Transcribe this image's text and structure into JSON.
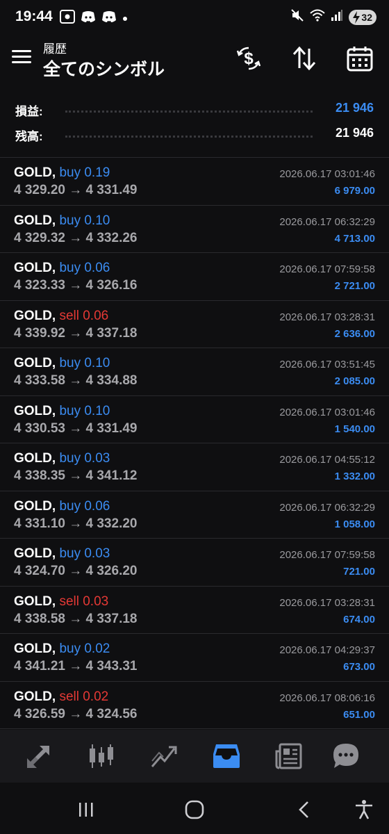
{
  "status_bar": {
    "time": "19:44",
    "battery": "32",
    "icons": [
      "screen-record-icon",
      "discord-icon",
      "discord-icon",
      "notification-dot-icon",
      "mute-icon",
      "wifi-icon",
      "signal-icon",
      "battery-icon"
    ]
  },
  "header": {
    "subtitle": "履歴",
    "title": "全てのシンボル",
    "icons": [
      "menu-icon",
      "currency-exchange-icon",
      "sort-icon",
      "calendar-icon"
    ]
  },
  "summary": {
    "profit_label": "損益:",
    "profit_value": "21 946",
    "balance_label": "残高:",
    "balance_value": "21 946"
  },
  "colors": {
    "background": "#0f0f11",
    "accent_blue": "#3b8cf2",
    "sell_red": "#e53935",
    "muted_text": "#a8a8ac"
  },
  "trades": [
    {
      "symbol": "GOLD,",
      "side": "buy",
      "volume": "buy 0.19",
      "prices": "4 329.20 → 4 331.49",
      "time": "2026.06.17 03:01:46",
      "profit": "6 979.00"
    },
    {
      "symbol": "GOLD,",
      "side": "buy",
      "volume": "buy 0.10",
      "prices": "4 329.32 → 4 332.26",
      "time": "2026.06.17 06:32:29",
      "profit": "4 713.00"
    },
    {
      "symbol": "GOLD,",
      "side": "buy",
      "volume": "buy 0.06",
      "prices": "4 323.33 → 4 326.16",
      "time": "2026.06.17 07:59:58",
      "profit": "2 721.00"
    },
    {
      "symbol": "GOLD,",
      "side": "sell",
      "volume": "sell 0.06",
      "prices": "4 339.92 → 4 337.18",
      "time": "2026.06.17 03:28:31",
      "profit": "2 636.00"
    },
    {
      "symbol": "GOLD,",
      "side": "buy",
      "volume": "buy 0.10",
      "prices": "4 333.58 → 4 334.88",
      "time": "2026.06.17 03:51:45",
      "profit": "2 085.00"
    },
    {
      "symbol": "GOLD,",
      "side": "buy",
      "volume": "buy 0.10",
      "prices": "4 330.53 → 4 331.49",
      "time": "2026.06.17 03:01:46",
      "profit": "1 540.00"
    },
    {
      "symbol": "GOLD,",
      "side": "buy",
      "volume": "buy 0.03",
      "prices": "4 338.35 → 4 341.12",
      "time": "2026.06.17 04:55:12",
      "profit": "1 332.00"
    },
    {
      "symbol": "GOLD,",
      "side": "buy",
      "volume": "buy 0.06",
      "prices": "4 331.10 → 4 332.20",
      "time": "2026.06.17 06:32:29",
      "profit": "1 058.00"
    },
    {
      "symbol": "GOLD,",
      "side": "buy",
      "volume": "buy 0.03",
      "prices": "4 324.70 → 4 326.20",
      "time": "2026.06.17 07:59:58",
      "profit": "721.00"
    },
    {
      "symbol": "GOLD,",
      "side": "sell",
      "volume": "sell 0.03",
      "prices": "4 338.58 → 4 337.18",
      "time": "2026.06.17 03:28:31",
      "profit": "674.00"
    },
    {
      "symbol": "GOLD,",
      "side": "buy",
      "volume": "buy 0.02",
      "prices": "4 341.21 → 4 343.31",
      "time": "2026.06.17 04:29:37",
      "profit": "673.00"
    },
    {
      "symbol": "GOLD,",
      "side": "sell",
      "volume": "sell 0.02",
      "prices": "4 326.59 → 4 324.56",
      "time": "2026.06.17 08:06:16",
      "profit": "651.00"
    }
  ],
  "bottom_nav": {
    "items": [
      "quotes-icon",
      "chart-icon",
      "trade-icon",
      "history-icon",
      "news-icon",
      "chat-icon"
    ],
    "active": "history-icon"
  },
  "system_nav": {
    "items": [
      "recents-icon",
      "home-icon",
      "back-icon",
      "accessibility-icon"
    ]
  }
}
